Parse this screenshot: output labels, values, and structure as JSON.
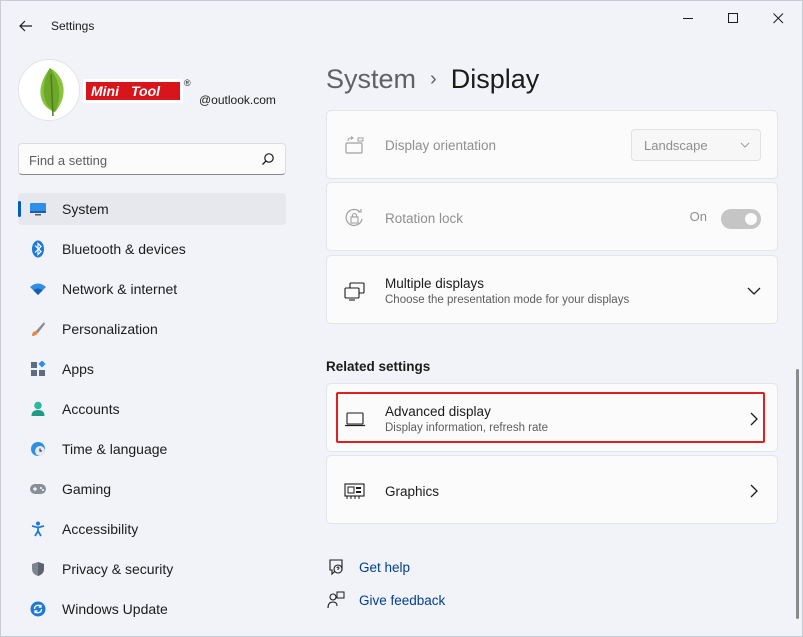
{
  "window": {
    "title": "Settings",
    "back_icon": "arrow-left-icon",
    "controls": [
      "minimize-icon",
      "maximize-icon",
      "close-icon"
    ]
  },
  "profile": {
    "brand": {
      "mini": "Mini",
      "tool": "Tool",
      "registered": "®"
    },
    "email": "@outlook.com"
  },
  "search": {
    "placeholder": "Find a setting",
    "value": ""
  },
  "sidebar": {
    "items": [
      {
        "label": "System",
        "icon": "monitor-icon",
        "selected": true
      },
      {
        "label": "Bluetooth & devices",
        "icon": "bluetooth-icon"
      },
      {
        "label": "Network & internet",
        "icon": "wifi-icon"
      },
      {
        "label": "Personalization",
        "icon": "brush-icon"
      },
      {
        "label": "Apps",
        "icon": "apps-icon"
      },
      {
        "label": "Accounts",
        "icon": "person-icon"
      },
      {
        "label": "Time & language",
        "icon": "clock-globe-icon"
      },
      {
        "label": "Gaming",
        "icon": "gamepad-icon"
      },
      {
        "label": "Accessibility",
        "icon": "accessibility-icon"
      },
      {
        "label": "Privacy & security",
        "icon": "shield-icon"
      },
      {
        "label": "Windows Update",
        "icon": "update-icon"
      }
    ]
  },
  "breadcrumb": {
    "parent": "System",
    "separator": "›",
    "current": "Display"
  },
  "settings": {
    "display_orientation": {
      "title": "Display orientation",
      "value": "Landscape",
      "enabled": false
    },
    "rotation_lock": {
      "title": "Rotation lock",
      "state": "On",
      "enabled": false
    },
    "multiple_displays": {
      "title": "Multiple displays",
      "subtitle": "Choose the presentation mode for your displays"
    }
  },
  "related": {
    "heading": "Related settings",
    "advanced_display": {
      "title": "Advanced display",
      "subtitle": "Display information, refresh rate",
      "highlighted": true
    },
    "graphics": {
      "title": "Graphics"
    }
  },
  "help": {
    "get_help": "Get help",
    "give_feedback": "Give feedback"
  },
  "colors": {
    "accent": "#005fb8",
    "highlight": "#e21f1f",
    "link": "#003e92"
  }
}
